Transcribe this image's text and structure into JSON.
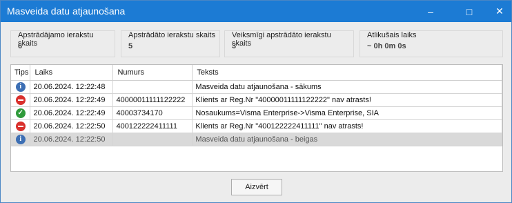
{
  "window": {
    "title": "Masveida datu atjaunošana"
  },
  "titlebar_buttons": {
    "minimize": "–",
    "maximize": "□",
    "close": "✕"
  },
  "stats": [
    {
      "label": "Apstrādājamo ierakstu skaits",
      "value": "6"
    },
    {
      "label": "Apstrādāto ierakstu skaits",
      "value": "5"
    },
    {
      "label": "Veiksmīgi apstrādāto ierakstu skaits",
      "value": "3"
    },
    {
      "label": "Atlikušais laiks",
      "value": "~ 0h 0m 0s"
    }
  ],
  "table": {
    "headers": [
      "Tips",
      "Laiks",
      "Numurs",
      "Teksts"
    ],
    "rows": [
      {
        "type": "info-icon",
        "time": "20.06.2024. 12:22:48",
        "number": "",
        "text": "Masveida datu atjaunošana - sākums",
        "selected": false
      },
      {
        "type": "error-icon",
        "time": "20.06.2024. 12:22:49",
        "number": "40000011111122222",
        "text": "Klients ar Reg.Nr \"40000011111122222\" nav atrasts!",
        "selected": false
      },
      {
        "type": "success-icon",
        "time": "20.06.2024. 12:22:49",
        "number": "40003734170",
        "text": "Nosaukums=Visma Enterprise->Visma Enterprise, SIA",
        "selected": false
      },
      {
        "type": "error-icon",
        "time": "20.06.2024. 12:22:50",
        "number": "400122222411111",
        "text": "Klients ar Reg.Nr \"400122222411111\" nav atrasts!",
        "selected": false
      },
      {
        "type": "info-icon",
        "time": "20.06.2024. 12:22:50",
        "number": "",
        "text": "Masveida datu atjaunošana - beigas",
        "selected": true
      }
    ]
  },
  "footer": {
    "close_label": "Aizvērt"
  },
  "colors": {
    "titlebar": "#1c7bd4",
    "info": "#3d6fb4",
    "error": "#d9302c",
    "success": "#2f9a3a"
  }
}
